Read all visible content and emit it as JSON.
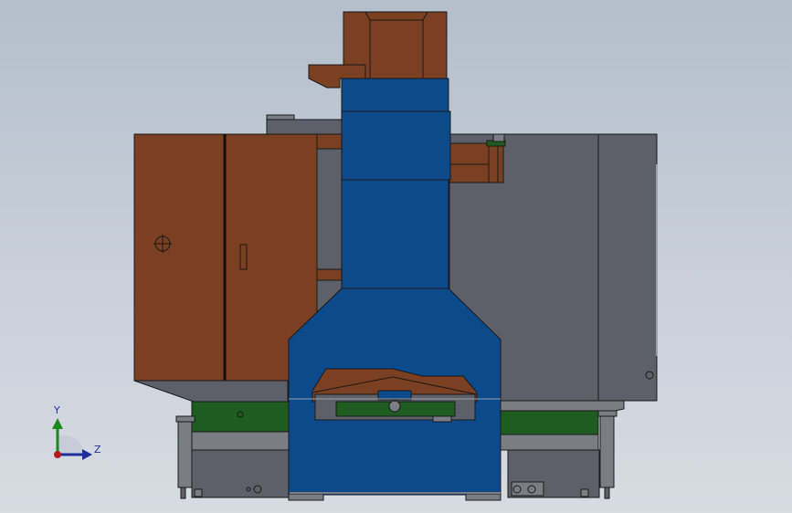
{
  "triad": {
    "y_label": "Y",
    "z_label": "Z",
    "colors": {
      "y": "#1a8a1a",
      "z": "#1d2f9e",
      "x": "#b31b1b"
    }
  },
  "palette": {
    "brown": "#7b3f22",
    "blue": "#0d4a8c",
    "gray": "#5d6069",
    "green": "#1f5c1f",
    "light_gray": "#7a7d84",
    "outline": "#1a1a1a"
  }
}
